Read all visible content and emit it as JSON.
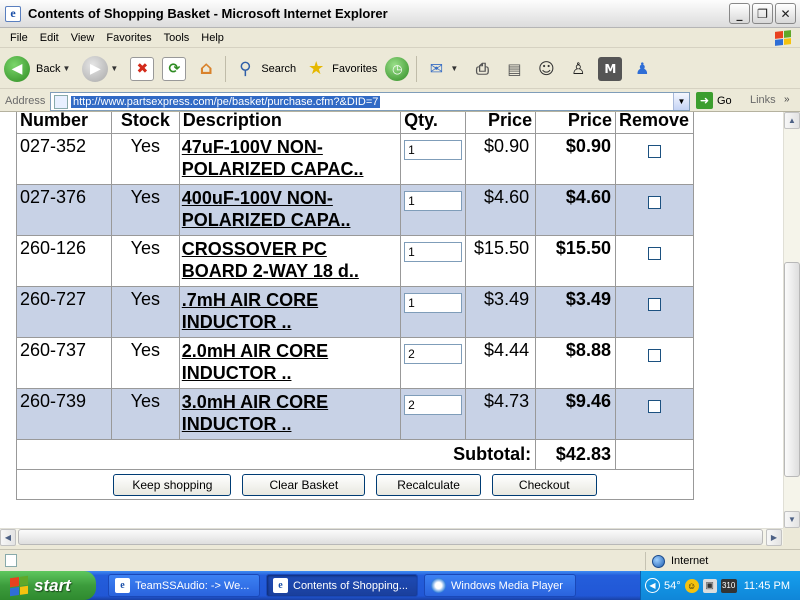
{
  "window": {
    "title": "Contents of Shopping Basket - Microsoft Internet Explorer"
  },
  "menu": [
    "File",
    "Edit",
    "View",
    "Favorites",
    "Tools",
    "Help"
  ],
  "toolbar": {
    "back_label": "Back",
    "search_label": "Search",
    "favorites_label": "Favorites"
  },
  "address": {
    "label": "Address",
    "url": "http://www.partsexpress.com/pe/basket/purchase.cfm?&DID=7",
    "go_label": "Go",
    "links_label": "Links"
  },
  "basket": {
    "headers": {
      "number": "Number",
      "stock": "Stock",
      "description": "Description",
      "qty": "Qty.",
      "price": "Price",
      "ext_price": "Price",
      "remove": "Remove"
    },
    "items": [
      {
        "number": "027-352",
        "stock": "Yes",
        "desc1": "47uF-100V NON-",
        "desc2": "POLARIZED CAPAC..",
        "qty": "1",
        "price": "$0.90",
        "ext": "$0.90"
      },
      {
        "number": "027-376",
        "stock": "Yes",
        "desc1": "400uF-100V NON-",
        "desc2": "POLARIZED CAPA..",
        "qty": "1",
        "price": "$4.60",
        "ext": "$4.60"
      },
      {
        "number": "260-126",
        "stock": "Yes",
        "desc1": "CROSSOVER PC",
        "desc2": "BOARD 2-WAY 18 d..",
        "qty": "1",
        "price": "$15.50",
        "ext": "$15.50"
      },
      {
        "number": "260-727",
        "stock": "Yes",
        "desc1": ".7mH AIR CORE",
        "desc2": "INDUCTOR ..",
        "qty": "1",
        "price": "$3.49",
        "ext": "$3.49"
      },
      {
        "number": "260-737",
        "stock": "Yes",
        "desc1": "2.0mH AIR CORE",
        "desc2": "INDUCTOR ..",
        "qty": "2",
        "price": "$4.44",
        "ext": "$8.88"
      },
      {
        "number": "260-739",
        "stock": "Yes",
        "desc1": "3.0mH AIR CORE",
        "desc2": "INDUCTOR ..",
        "qty": "2",
        "price": "$4.73",
        "ext": "$9.46"
      }
    ],
    "subtotal_label": "Subtotal:",
    "subtotal_value": "$42.83",
    "buttons": {
      "keep": "Keep shopping",
      "clear": "Clear Basket",
      "recalc": "Recalculate",
      "checkout": "Checkout"
    }
  },
  "status": {
    "zone": "Internet"
  },
  "taskbar": {
    "start": "start",
    "tasks": [
      "TeamSSAudio: -> We...",
      "Contents of Shopping...",
      "Windows Media Player"
    ],
    "temp": "54°",
    "clock": "11:45 PM"
  }
}
